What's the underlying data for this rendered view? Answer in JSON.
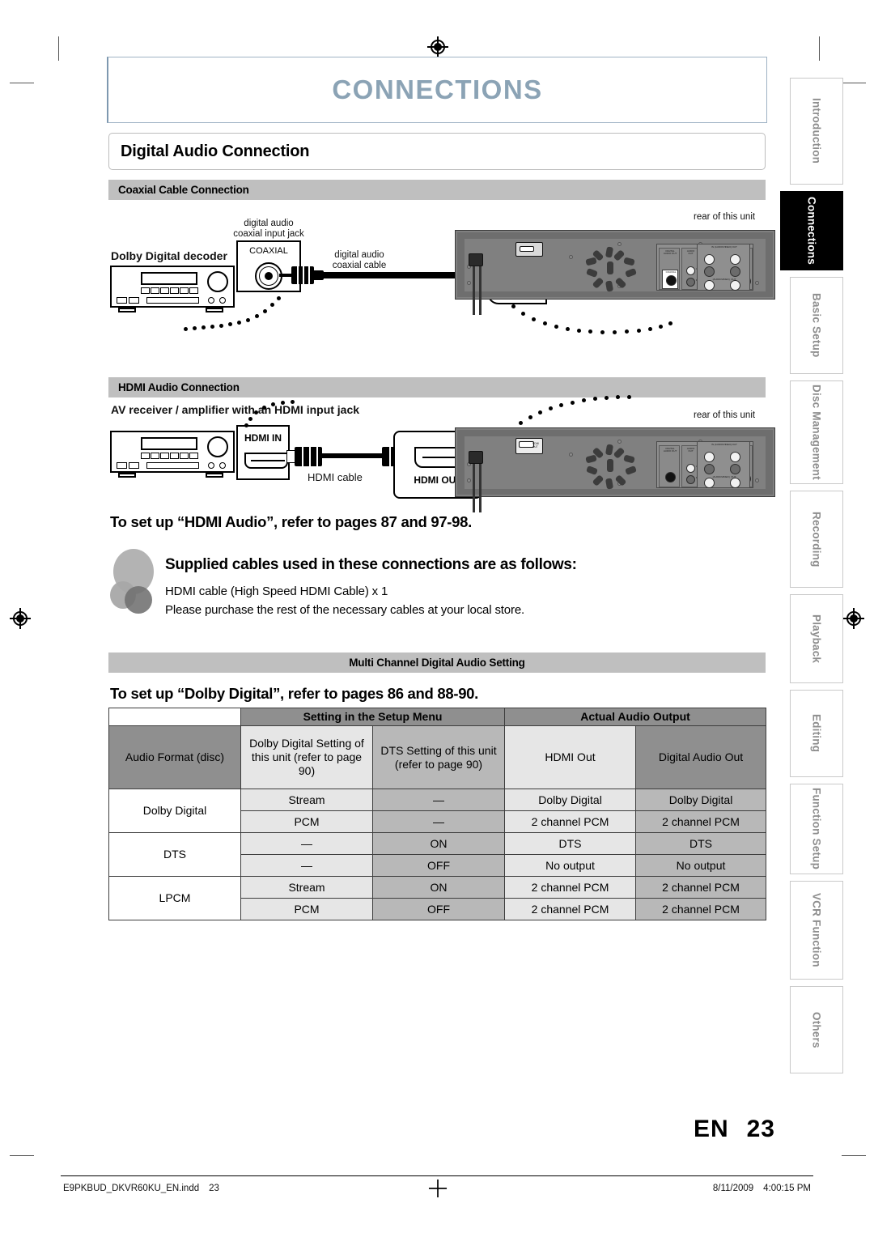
{
  "header": {
    "chapter_title": "CONNECTIONS",
    "section_title": "Digital Audio Connection"
  },
  "coaxial_section": {
    "subhead": "Coaxial Cable Connection",
    "device_label": "Dolby Digital decoder",
    "jack_label_line1": "digital audio",
    "jack_label_line2": "coaxial input jack",
    "jack_caption": "COAXIAL",
    "cable_label_line1": "digital audio",
    "cable_label_line2": "coaxial cable",
    "unit_jack_caption": "COAXIAL",
    "rear_label": "rear of this unit"
  },
  "hdmi_section": {
    "subhead": "HDMI Audio Connection",
    "device_label": "AV receiver / amplifier with an HDMI input jack",
    "input_port_caption": "HDMI IN",
    "cable_label": "HDMI cable",
    "output_port_caption": "HDMI OUT",
    "rear_label": "rear of this unit"
  },
  "notes": {
    "hdmi_setup_note": "To set up “HDMI Audio”, refer to pages 87 and 97-98.",
    "supplied_heading": "Supplied cables used in these connections are as follows:",
    "supplied_line1": "HDMI cable (High Speed HDMI Cable) x 1",
    "supplied_line2": "Please purchase the rest of the necessary cables at your local store.",
    "dolby_setup_note": "To set up “Dolby Digital”, refer to pages 86 and 88-90."
  },
  "multichannel": {
    "bar_title": "Multi Channel Digital Audio Setting",
    "group_headers": {
      "setup_menu": "Setting in the Setup Menu",
      "actual_output": "Actual Audio Output"
    },
    "columns": {
      "audio_format": "Audio Format (disc)",
      "dolby_setting": "Dolby Digital Setting of this unit (refer to page 90)",
      "dts_setting": "DTS Setting of this unit (refer to page 90)",
      "hdmi_out": "HDMI Out",
      "digital_audio_out": "Digital Audio Out"
    },
    "rows": [
      {
        "format": "Dolby Digital",
        "sub": [
          {
            "dolby": "Stream",
            "dts": "—",
            "hdmi": "Dolby Digital",
            "digital": "Dolby Digital"
          },
          {
            "dolby": "PCM",
            "dts": "—",
            "hdmi": "2 channel PCM",
            "digital": "2 channel PCM"
          }
        ]
      },
      {
        "format": "DTS",
        "sub": [
          {
            "dolby": "—",
            "dts": "ON",
            "hdmi": "DTS",
            "digital": "DTS"
          },
          {
            "dolby": "—",
            "dts": "OFF",
            "hdmi": "No output",
            "digital": "No output"
          }
        ]
      },
      {
        "format": "LPCM",
        "sub": [
          {
            "dolby": "Stream",
            "dts": "ON",
            "hdmi": "2 channel PCM",
            "digital": "2 channel PCM"
          },
          {
            "dolby": "PCM",
            "dts": "OFF",
            "hdmi": "2 channel PCM",
            "digital": "2 channel PCM"
          }
        ]
      }
    ]
  },
  "side_tabs": [
    {
      "label": "Introduction",
      "active": false
    },
    {
      "label": "Connections",
      "active": true
    },
    {
      "label": "Basic Setup",
      "active": false
    },
    {
      "label": "Disc Management",
      "active": false
    },
    {
      "label": "Recording",
      "active": false
    },
    {
      "label": "Playback",
      "active": false
    },
    {
      "label": "Editing",
      "active": false
    },
    {
      "label": "Function Setup",
      "active": false
    },
    {
      "label": "VCR Function",
      "active": false
    },
    {
      "label": "Others",
      "active": false
    }
  ],
  "page_footer": {
    "lang": "EN",
    "page_number": "23",
    "file_name": "E9PKBUD_DKVR60KU_EN.indd",
    "file_page": "23",
    "date": "8/11/2009",
    "time": "4:00:15 PM"
  }
}
